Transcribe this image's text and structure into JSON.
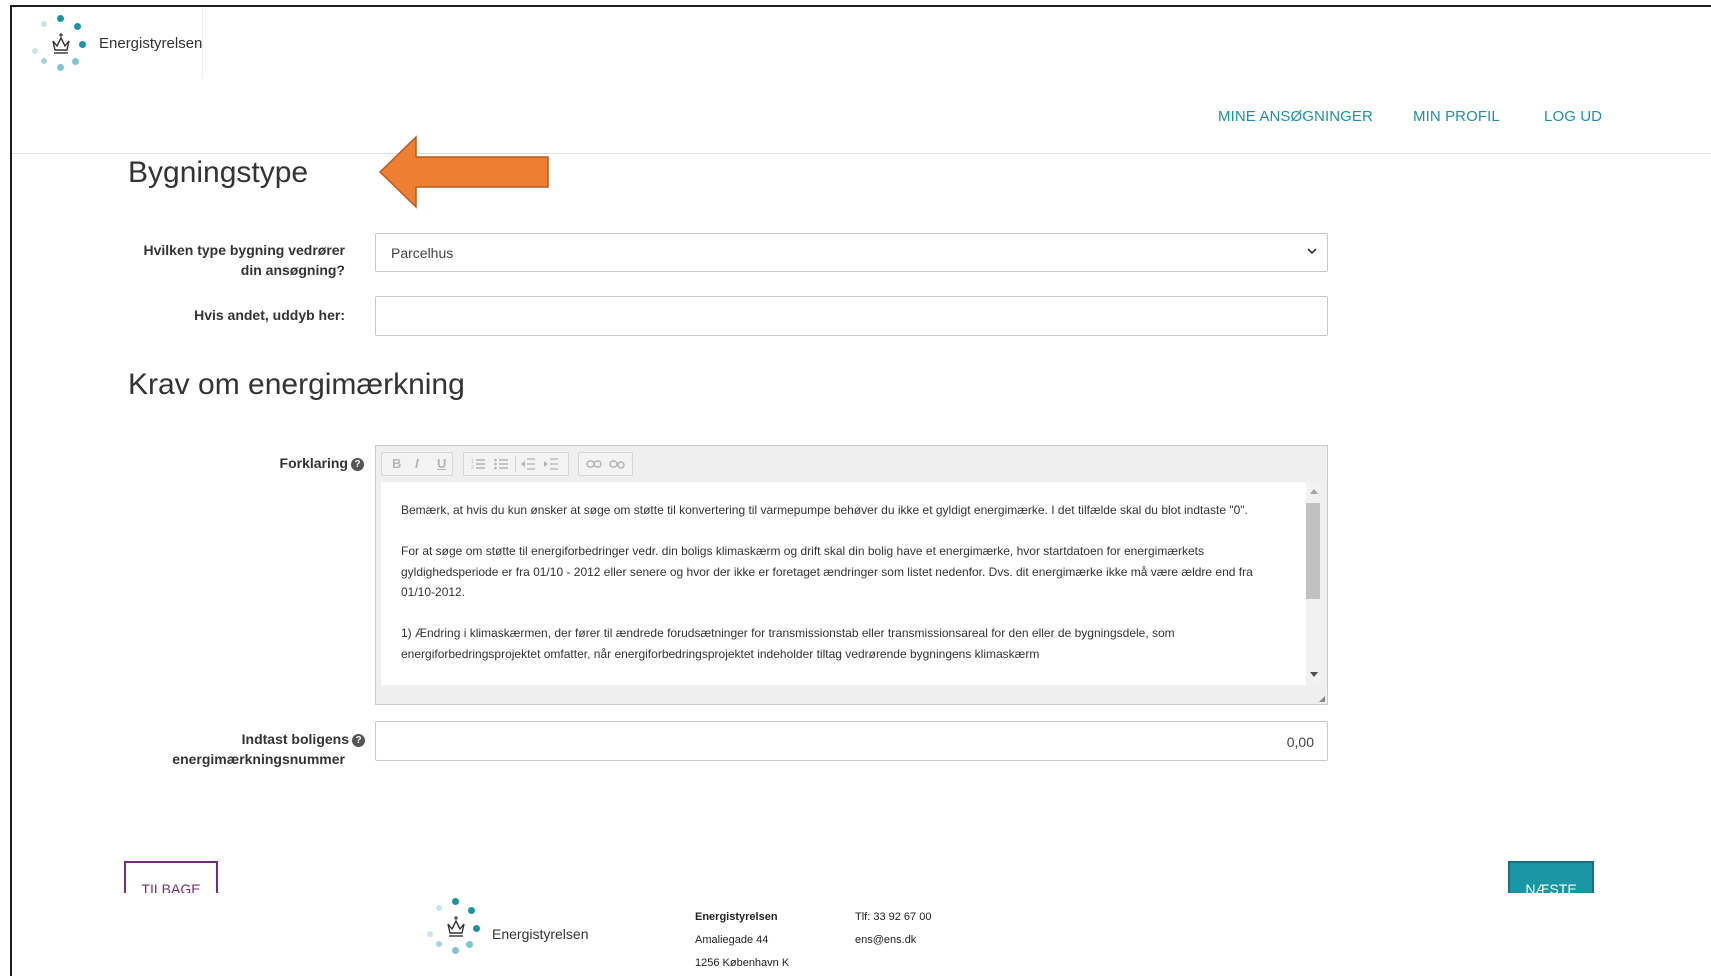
{
  "header": {
    "brand": "Energistyrelsen",
    "nav": [
      "MINE ANSØGNINGER",
      "MIN PROFIL",
      "LOG UD"
    ]
  },
  "colors": {
    "accent": "#1a96a5",
    "arrow": "#ee7f32",
    "back_button": "#7a2a7a"
  },
  "section1": {
    "title": "Bygningstype",
    "building_type_label": "Hvilken type bygning vedrører din ansøgning?",
    "building_type_value": "Parcelhus",
    "other_label": "Hvis andet, uddyb her:",
    "other_value": ""
  },
  "section2": {
    "title": "Krav om energimærkning",
    "explanation_label": "Forklaring",
    "toolbar": [
      "B",
      "I",
      "U",
      "ordered-list-icon",
      "bullet-list-icon",
      "outdent-icon",
      "indent-icon",
      "link-icon",
      "unlink-icon"
    ],
    "explanation_paragraphs": [
      "Bemærk, at hvis du kun ønsker at søge om støtte til konvertering til varmepumpe behøver du ikke et gyldigt energimærke. I det tilfælde skal du blot indtaste \"0\".",
      "For at søge om støtte til energiforbedringer vedr. din boligs klimaskærm og drift skal din bolig have et energimærke, hvor startdatoen for energimærkets gyldighedsperiode er fra 01/10 - 2012 eller senere og hvor der ikke er foretaget ændringer som listet nedenfor. Dvs. dit energimærke ikke må være ældre end fra 01/10-2012.",
      "1) Ændring i klimaskærmen, der fører til ændrede forudsætninger for transmissionstab eller transmissionsareal for den eller de bygningsdele, som energiforbedringsprojektet omfatter, når energiforbedringsprojektet indeholder tiltag vedrørende bygningens klimaskærm"
    ],
    "number_label_1": "Indtast boligens",
    "number_label_2": "energimærkningsnummer",
    "number_value": "0,00"
  },
  "buttons": {
    "back": "TILBAGE",
    "next": "NÆSTE"
  },
  "footer": {
    "brand": "Energistyrelsen",
    "org": "Energistyrelsen",
    "street": "Amaliegade 44",
    "city": "1256 København K",
    "phone": "Tlf: 33 92 67 00",
    "email": "ens@ens.dk"
  }
}
